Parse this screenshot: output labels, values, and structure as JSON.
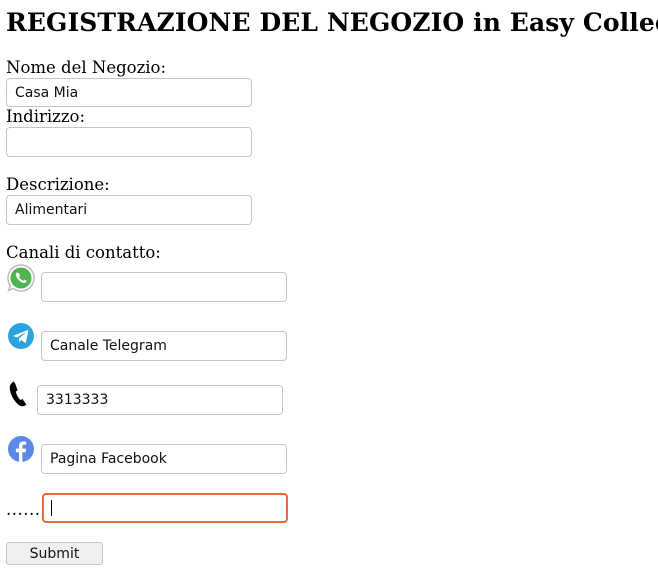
{
  "title": "REGISTRAZIONE DEL NEGOZIO in Easy Collect",
  "form": {
    "name_label": "Nome del Negozio:",
    "name_value": "Casa Mia",
    "address_label": "Indirizzo:",
    "address_value": "",
    "description_label": "Descrizione:",
    "description_value": "Alimentari",
    "contacts_label": "Canali di contatto:",
    "whatsapp_value": "",
    "telegram_value": "Canale Telegram",
    "phone_value": "3313333",
    "facebook_value": "Pagina Facebook",
    "other_label": "......",
    "other_value": "",
    "submit_label": "Submit"
  },
  "icons": {
    "whatsapp": "whatsapp-icon",
    "telegram": "telegram-icon",
    "phone": "phone-icon",
    "facebook": "facebook-icon"
  },
  "colors": {
    "whatsapp": "#4fb34f",
    "telegram": "#2aa3df",
    "facebook": "#5b89e5",
    "focus_border": "#e56a3c"
  }
}
